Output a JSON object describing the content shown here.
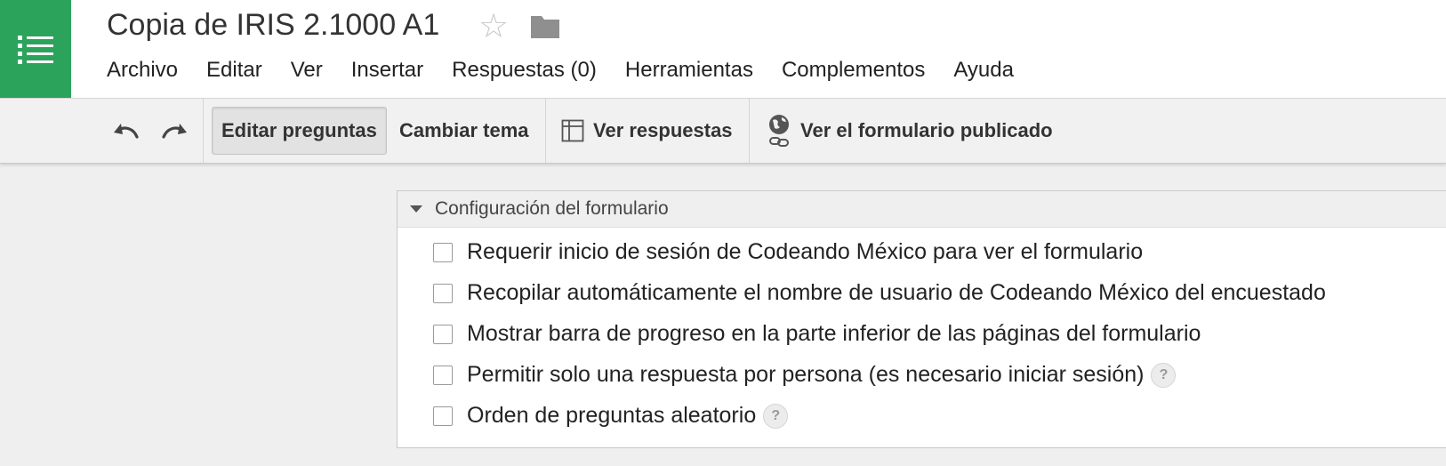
{
  "document": {
    "title": "Copia de IRIS 2.1000 A1"
  },
  "menu": [
    "Archivo",
    "Editar",
    "Ver",
    "Insertar",
    "Respuestas (0)",
    "Herramientas",
    "Complementos",
    "Ayuda"
  ],
  "toolbar": {
    "edit_questions": "Editar preguntas",
    "change_theme": "Cambiar tema",
    "view_responses": "Ver respuestas",
    "view_published": "Ver el formulario publicado"
  },
  "settings": {
    "header": "Configuración del formulario",
    "options": [
      {
        "label": "Requerir inicio de sesión de Codeando México para ver el formulario",
        "checked": false,
        "help": false
      },
      {
        "label": "Recopilar automáticamente el nombre de usuario de Codeando México del encuestado",
        "checked": false,
        "help": false
      },
      {
        "label": "Mostrar barra de progreso en la parte inferior de las páginas del formulario",
        "checked": false,
        "help": false
      },
      {
        "label": "Permitir solo una respuesta por persona (es necesario iniciar sesión)",
        "checked": false,
        "help": true
      },
      {
        "label": "Orden de preguntas aleatorio",
        "checked": false,
        "help": true
      }
    ],
    "help_glyph": "?"
  },
  "colors": {
    "brand_green": "#2ba35a",
    "toolbar_bg": "#f1f1f1",
    "page_bg": "#efefef"
  },
  "icons": [
    "apps-list-icon",
    "star-icon",
    "folder-icon",
    "undo-icon",
    "redo-icon",
    "table-icon",
    "globe-link-icon",
    "help-icon"
  ]
}
